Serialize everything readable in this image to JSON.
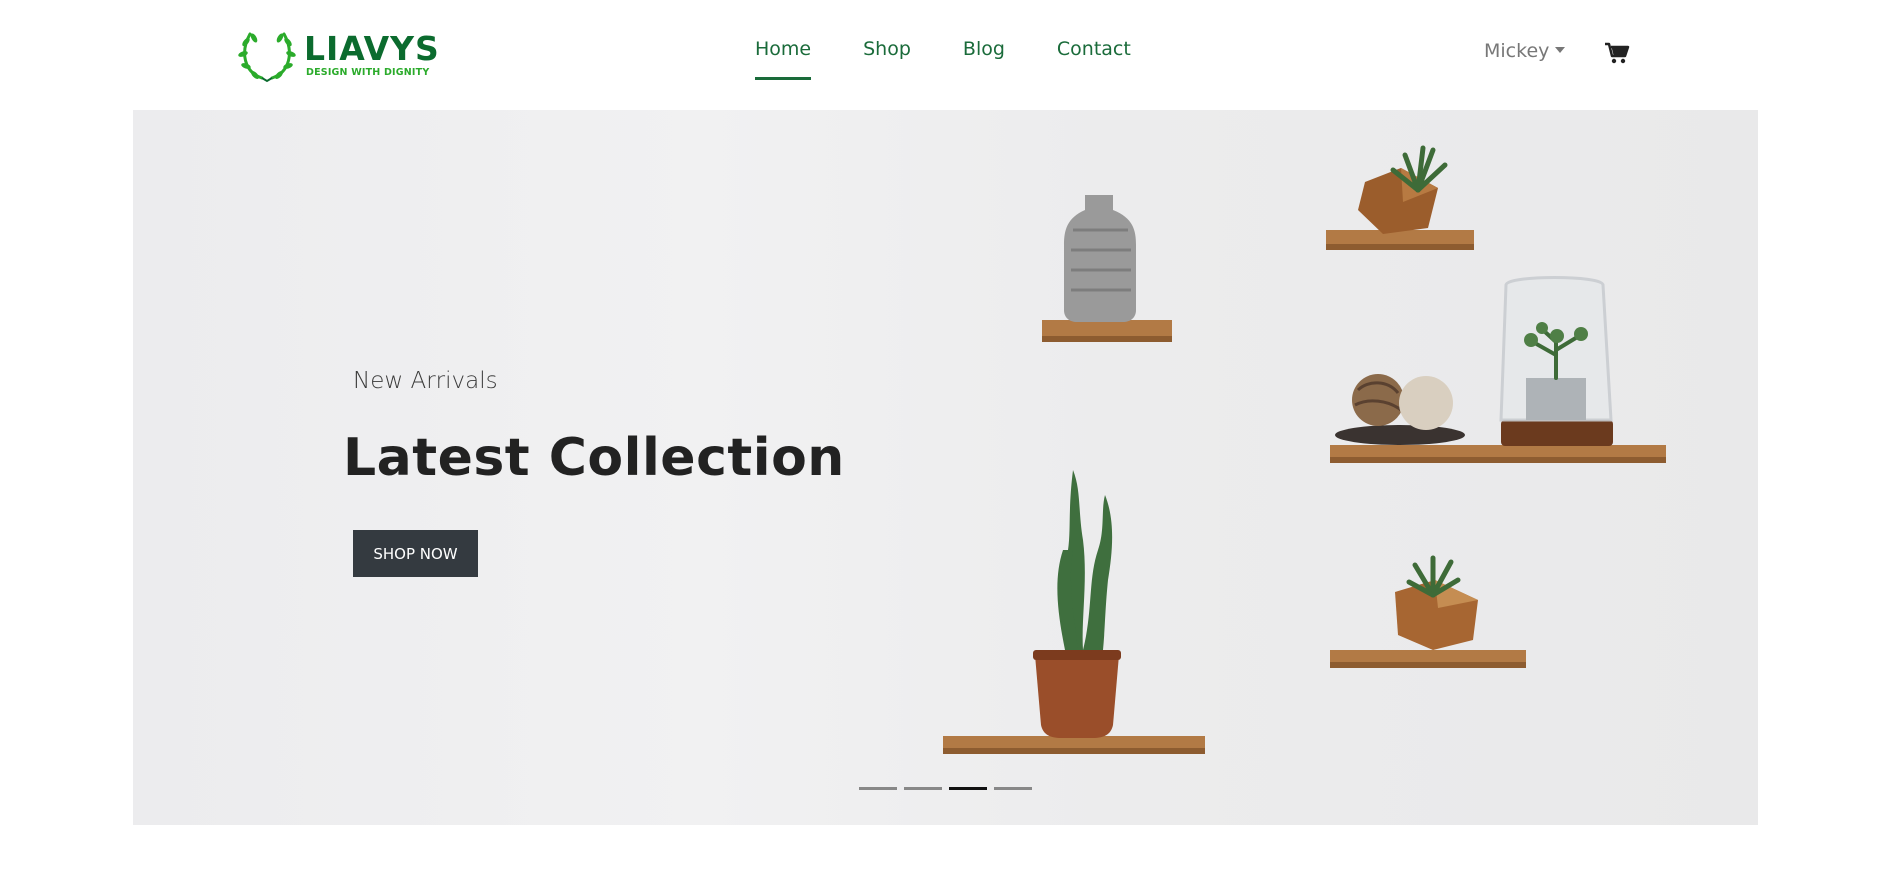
{
  "brand": {
    "name": "LIAVYS",
    "tagline": "DESIGN WITH DIGNITY",
    "color": "#0b6b2e",
    "accent": "#2bab2b"
  },
  "nav": {
    "items": [
      {
        "label": "Home",
        "active": true
      },
      {
        "label": "Shop",
        "active": false
      },
      {
        "label": "Blog",
        "active": false
      },
      {
        "label": "Contact",
        "active": false
      }
    ]
  },
  "user": {
    "name": "Mickey",
    "menu_icon": "chevron-down-icon"
  },
  "cart": {
    "icon": "cart-icon"
  },
  "hero": {
    "subtitle": "New Arrivals",
    "title": "Latest Collection",
    "cta_label": "SHOP NOW",
    "slides_total": 4,
    "active_slide": 3
  }
}
